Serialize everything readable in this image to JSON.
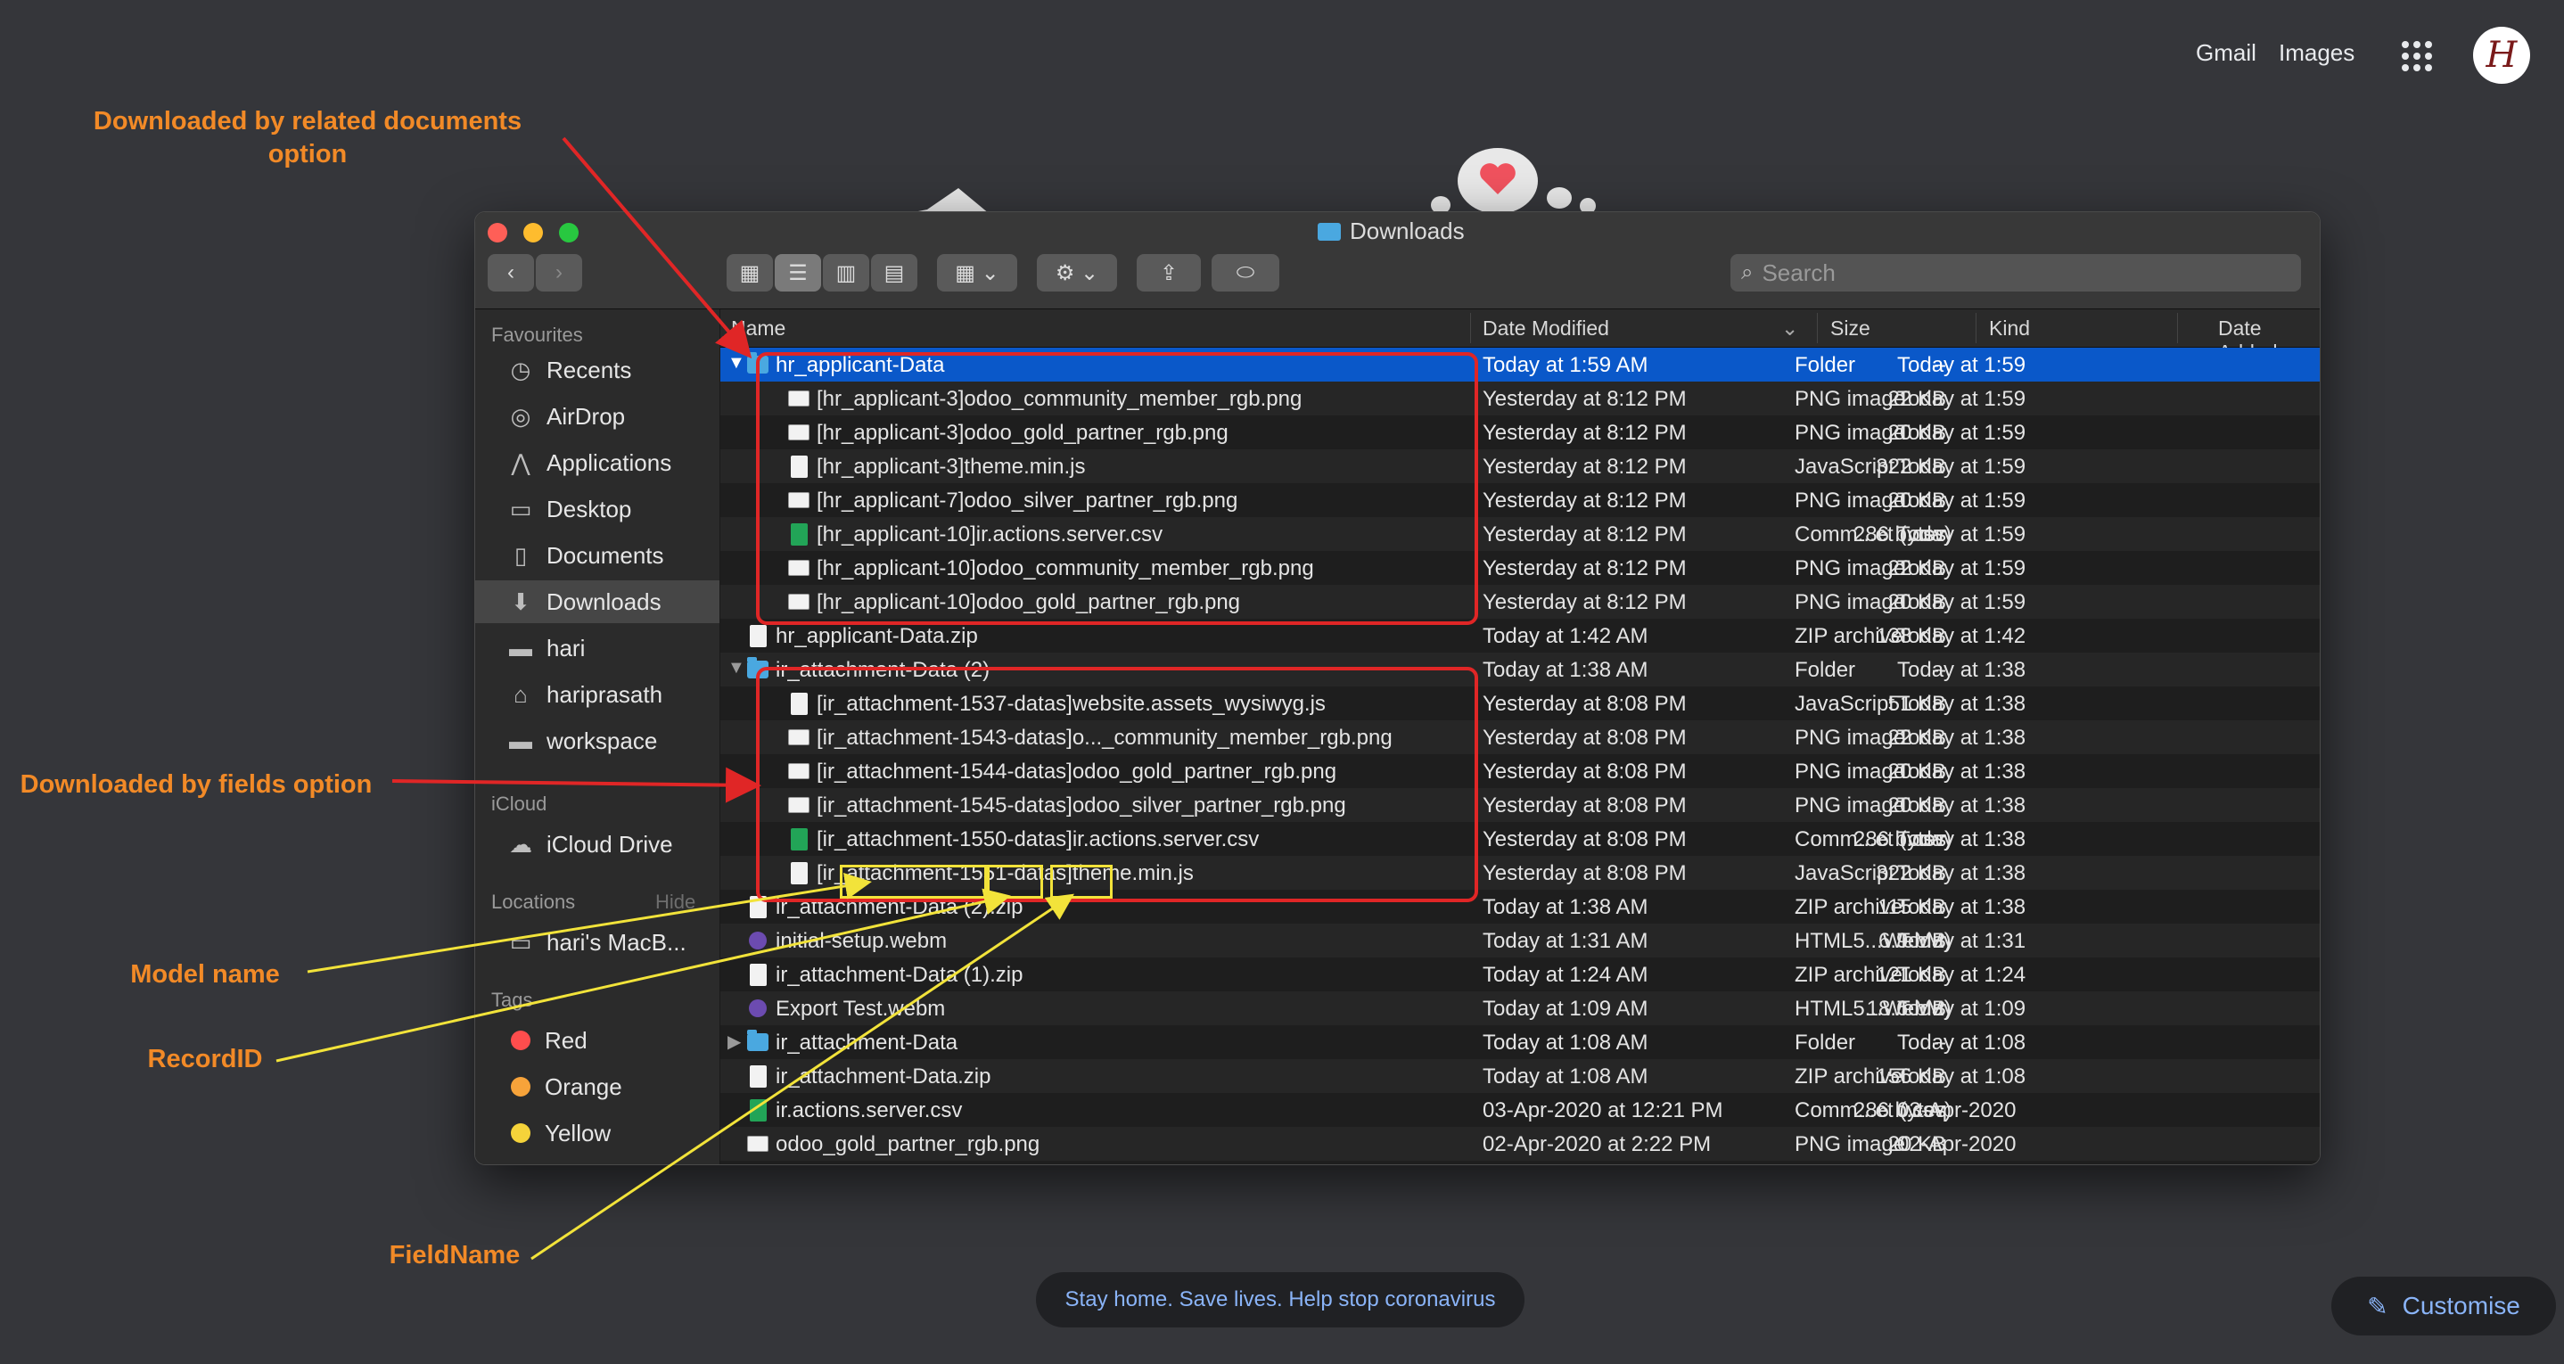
{
  "google": {
    "gmail": "Gmail",
    "images": "Images",
    "avatar_letter": "H"
  },
  "annotations": {
    "related_docs": "Downloaded by related documents option",
    "fields_option": "Downloaded by fields option",
    "model_name": "Model name",
    "record_id": "RecordID",
    "field_name": "FieldName"
  },
  "finder": {
    "title": "Downloads",
    "search_placeholder": "Search",
    "sidebar": {
      "favourites_heading": "Favourites",
      "favourites": [
        {
          "label": "Recents",
          "icon": "clock-icon"
        },
        {
          "label": "AirDrop",
          "icon": "airdrop-icon"
        },
        {
          "label": "Applications",
          "icon": "applications-icon"
        },
        {
          "label": "Desktop",
          "icon": "desktop-icon"
        },
        {
          "label": "Documents",
          "icon": "document-icon"
        },
        {
          "label": "Downloads",
          "icon": "download-icon",
          "selected": true
        },
        {
          "label": "hari",
          "icon": "folder-icon"
        },
        {
          "label": "hariprasath",
          "icon": "home-icon"
        },
        {
          "label": "workspace",
          "icon": "folder-icon"
        }
      ],
      "icloud_heading": "iCloud",
      "icloud": [
        {
          "label": "iCloud Drive",
          "icon": "cloud-icon"
        }
      ],
      "locations_heading": "Locations",
      "locations_hide": "Hide",
      "locations": [
        {
          "label": "hari's MacB...",
          "icon": "laptop-icon"
        }
      ],
      "tags_heading": "Tags",
      "tags": [
        {
          "label": "Red",
          "color": "#ff4d4d"
        },
        {
          "label": "Orange",
          "color": "#f7a33a"
        },
        {
          "label": "Yellow",
          "color": "#f5d33a"
        }
      ]
    },
    "columns": {
      "name": "Name",
      "date_modified": "Date Modified",
      "size": "Size",
      "kind": "Kind",
      "date_added": "Date Added"
    },
    "rows": [
      {
        "name": "hr_applicant-Data",
        "date": "Today at 1:59 AM",
        "size": "--",
        "kind": "Folder",
        "added": "Today at 1:59",
        "icon": "folder",
        "disclosure": "open"
      },
      {
        "name": "[hr_applicant-3]odoo_community_member_rgb.png",
        "date": "Yesterday at 8:12 PM",
        "size": "22 KB",
        "kind": "PNG image",
        "added": "Today at 1:59",
        "icon": "png"
      },
      {
        "name": "[hr_applicant-3]odoo_gold_partner_rgb.png",
        "date": "Yesterday at 8:12 PM",
        "size": "20 KB",
        "kind": "PNG image",
        "added": "Today at 1:59",
        "icon": "png"
      },
      {
        "name": "[hr_applicant-3]theme.min.js",
        "date": "Yesterday at 8:12 PM",
        "size": "322 KB",
        "kind": "JavaScript",
        "added": "Today at 1:59",
        "icon": "doc"
      },
      {
        "name": "[hr_applicant-7]odoo_silver_partner_rgb.png",
        "date": "Yesterday at 8:12 PM",
        "size": "20 KB",
        "kind": "PNG image",
        "added": "Today at 1:59",
        "icon": "png"
      },
      {
        "name": "[hr_applicant-10]ir.actions.server.csv",
        "date": "Yesterday at 8:12 PM",
        "size": "286 bytes",
        "kind": "Comm...et (.csv)",
        "added": "Today at 1:59",
        "icon": "csv"
      },
      {
        "name": "[hr_applicant-10]odoo_community_member_rgb.png",
        "date": "Yesterday at 8:12 PM",
        "size": "22 KB",
        "kind": "PNG image",
        "added": "Today at 1:59",
        "icon": "png"
      },
      {
        "name": "[hr_applicant-10]odoo_gold_partner_rgb.png",
        "date": "Yesterday at 8:12 PM",
        "size": "20 KB",
        "kind": "PNG image",
        "added": "Today at 1:59",
        "icon": "png"
      },
      {
        "name": "hr_applicant-Data.zip",
        "date": "Today at 1:42 AM",
        "size": "138 KB",
        "kind": "ZIP archive",
        "added": "Today at 1:42",
        "icon": "doc"
      },
      {
        "name": "ir_attachment-Data (2)",
        "date": "Today at 1:38 AM",
        "size": "--",
        "kind": "Folder",
        "added": "Today at 1:38",
        "icon": "folder",
        "disclosure": "open"
      },
      {
        "name": "[ir_attachment-1537-datas]website.assets_wysiwyg.js",
        "date": "Yesterday at 8:08 PM",
        "size": "51 KB",
        "kind": "JavaScript",
        "added": "Today at 1:38",
        "icon": "doc"
      },
      {
        "name": "[ir_attachment-1543-datas]o..._community_member_rgb.png",
        "date": "Yesterday at 8:08 PM",
        "size": "22 KB",
        "kind": "PNG image",
        "added": "Today at 1:38",
        "icon": "png"
      },
      {
        "name": "[ir_attachment-1544-datas]odoo_gold_partner_rgb.png",
        "date": "Yesterday at 8:08 PM",
        "size": "20 KB",
        "kind": "PNG image",
        "added": "Today at 1:38",
        "icon": "png"
      },
      {
        "name": "[ir_attachment-1545-datas]odoo_silver_partner_rgb.png",
        "date": "Yesterday at 8:08 PM",
        "size": "20 KB",
        "kind": "PNG image",
        "added": "Today at 1:38",
        "icon": "png"
      },
      {
        "name": "[ir_attachment-1550-datas]ir.actions.server.csv",
        "date": "Yesterday at 8:08 PM",
        "size": "286 bytes",
        "kind": "Comm...et (.csv)",
        "added": "Today at 1:38",
        "icon": "csv"
      },
      {
        "name": "[ir_attachment-1551-datas]theme.min.js",
        "date": "Yesterday at 8:08 PM",
        "size": "322 KB",
        "kind": "JavaScript",
        "added": "Today at 1:38",
        "icon": "doc"
      },
      {
        "name": "ir_attachment-Data (2).zip",
        "date": "Today at 1:38 AM",
        "size": "115 KB",
        "kind": "ZIP archive",
        "added": "Today at 1:38",
        "icon": "doc"
      },
      {
        "name": "initial-setup.webm",
        "date": "Today at 1:31 AM",
        "size": "6.9 MB",
        "kind": "HTML5...WebM)",
        "added": "Today at 1:31",
        "icon": "webm"
      },
      {
        "name": "ir_attachment-Data (1).zip",
        "date": "Today at 1:24 AM",
        "size": "121 KB",
        "kind": "ZIP archive",
        "added": "Today at 1:24",
        "icon": "doc"
      },
      {
        "name": "Export Test.webm",
        "date": "Today at 1:09 AM",
        "size": "18.6 MB",
        "kind": "HTML5...WebM)",
        "added": "Today at 1:09",
        "icon": "webm"
      },
      {
        "name": "ir_attachment-Data",
        "date": "Today at 1:08 AM",
        "size": "--",
        "kind": "Folder",
        "added": "Today at 1:08",
        "icon": "folder",
        "disclosure": "closed"
      },
      {
        "name": "ir_attachment-Data.zip",
        "date": "Today at 1:08 AM",
        "size": "156 KB",
        "kind": "ZIP archive",
        "added": "Today at 1:08",
        "icon": "doc"
      },
      {
        "name": "ir.actions.server.csv",
        "date": "03-Apr-2020 at 12:21 PM",
        "size": "286 bytes",
        "kind": "Comm...et (.csv)",
        "added": "03-Apr-2020",
        "icon": "csv"
      },
      {
        "name": "odoo_gold_partner_rgb.png",
        "date": "02-Apr-2020 at 2:22 PM",
        "size": "20 KB",
        "kind": "PNG image",
        "added": "02-Apr-2020",
        "icon": "png"
      }
    ]
  },
  "banner": "Stay home. Save lives. Help stop coronavirus",
  "customise": "Customise"
}
